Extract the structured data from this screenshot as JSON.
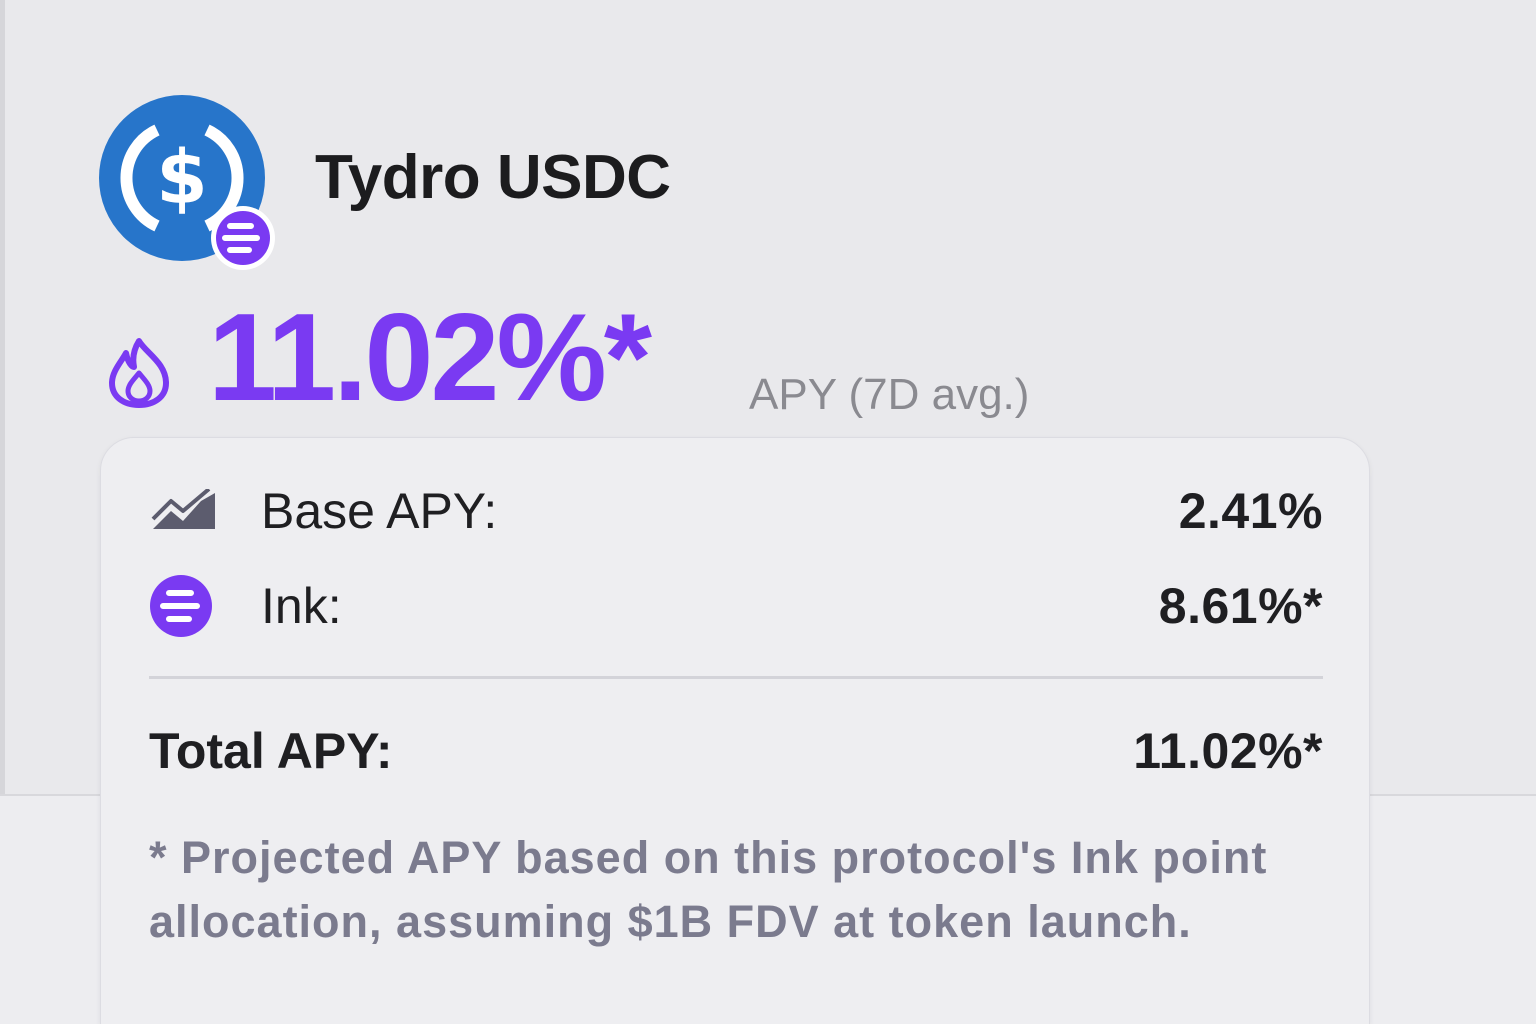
{
  "token": {
    "name": "Tydro USDC",
    "logo_icon": "usdc-logo-icon",
    "badge_icon": "ink-badge-icon"
  },
  "headline": {
    "icon": "fire-icon",
    "apy": "11.02%*",
    "apy_caption": "APY (7D avg.)"
  },
  "breakdown": {
    "rows": [
      {
        "icon": "chart-area-icon",
        "label": "Base APY:",
        "value": "2.41%"
      },
      {
        "icon": "ink-icon",
        "label": "Ink:",
        "value": "8.61%*"
      }
    ],
    "total": {
      "label": "Total APY:",
      "value": "11.02%*"
    },
    "note": "* Projected APY based on this protocol's Ink point allocation, assuming $1B FDV at token launch."
  },
  "colors": {
    "accent": "#7a3af2",
    "usdc_blue": "#2775ca",
    "text": "#1f1f22",
    "muted": "#8a8a90"
  }
}
